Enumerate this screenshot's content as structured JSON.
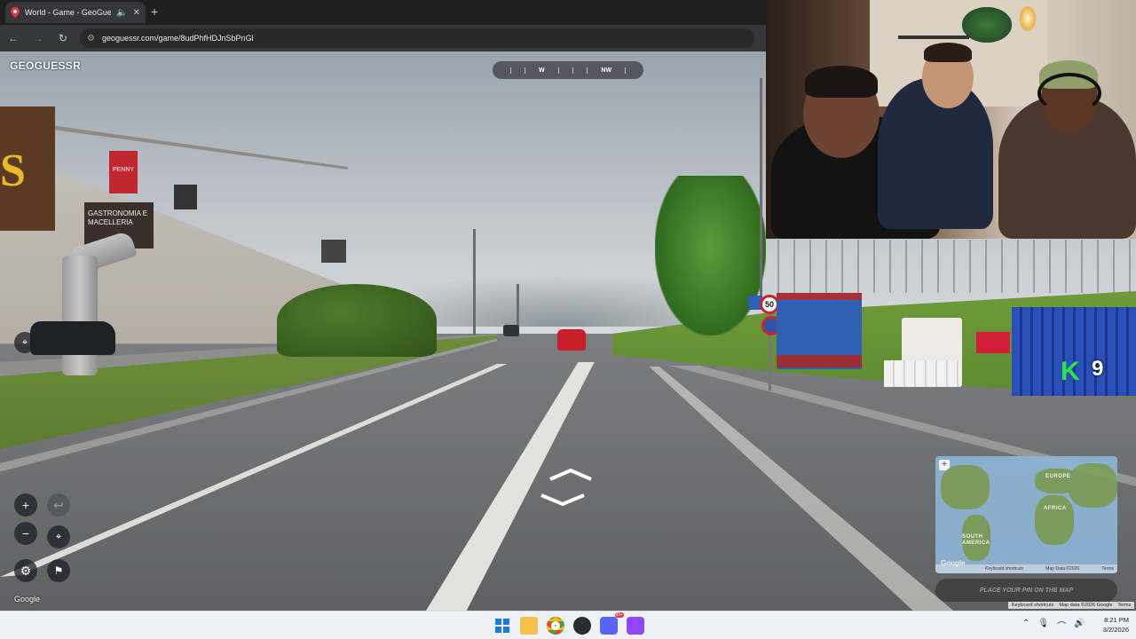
{
  "browser": {
    "tab_title": "World - Game - GeoGuessr",
    "new_tab_icon": "plus-icon",
    "url": "geoguessr.com/game/8udPhfHDJnSbPnGl"
  },
  "game": {
    "logo": "GEOGUESSR",
    "compass": {
      "labels": [
        "W",
        "NW"
      ]
    },
    "google_watermark": "Google",
    "speed_sign": "50",
    "streamer_badge": {
      "letter": "K",
      "number": "9"
    },
    "building_signs": {
      "billboard": "S",
      "red_sign": "PENNY",
      "dark_sign": "GASTRONOMIA E MACELLERIA"
    }
  },
  "minimap": {
    "labels": [
      "EUROPE",
      "AFRICA",
      "SOUTH AMERICA"
    ],
    "google_logo": "Google",
    "footer": [
      "Keyboard shortcuts",
      "Map Data ©2026",
      "Terms"
    ],
    "guess_button": "PLACE YOUR PIN ON THE MAP"
  },
  "attribution": [
    "Keyboard shortcuts",
    "Map data ©2026 Google",
    "Terms"
  ],
  "taskbar": {
    "time": "8:21 PM",
    "date": "3/2/2026",
    "chat_badge": "99+"
  },
  "colors": {
    "geoguessr_red": "#e8334a",
    "streamer_green": "#2fe14a",
    "chrome_bg": "#202124"
  }
}
